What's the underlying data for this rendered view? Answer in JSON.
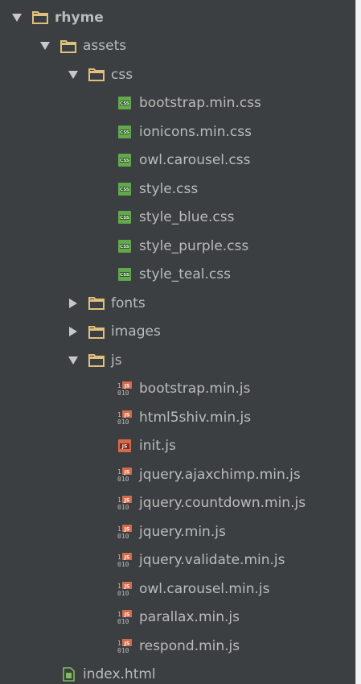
{
  "colors": {
    "background": "#3c3f41",
    "text": "#bbbbbb",
    "folder": "#e0c07a",
    "css_icon": "#62a84d",
    "js_icon": "#d46a4b",
    "html_icon": "#7fbe5a"
  },
  "tree": [
    {
      "label": "rhyme",
      "depth": 0,
      "type": "folder",
      "expanded": true,
      "icon": "folder-icon"
    },
    {
      "label": "assets",
      "depth": 1,
      "type": "folder",
      "expanded": true,
      "icon": "folder-icon"
    },
    {
      "label": "css",
      "depth": 2,
      "type": "folder",
      "expanded": true,
      "icon": "folder-icon"
    },
    {
      "label": "bootstrap.min.css",
      "depth": 3,
      "type": "css",
      "icon": "css-file-icon"
    },
    {
      "label": "ionicons.min.css",
      "depth": 3,
      "type": "css",
      "icon": "css-file-icon"
    },
    {
      "label": "owl.carousel.css",
      "depth": 3,
      "type": "css",
      "icon": "css-file-icon"
    },
    {
      "label": "style.css",
      "depth": 3,
      "type": "css",
      "icon": "css-file-icon"
    },
    {
      "label": "style_blue.css",
      "depth": 3,
      "type": "css",
      "icon": "css-file-icon"
    },
    {
      "label": "style_purple.css",
      "depth": 3,
      "type": "css",
      "icon": "css-file-icon"
    },
    {
      "label": "style_teal.css",
      "depth": 3,
      "type": "css",
      "icon": "css-file-icon"
    },
    {
      "label": "fonts",
      "depth": 2,
      "type": "folder",
      "expanded": false,
      "icon": "folder-icon"
    },
    {
      "label": "images",
      "depth": 2,
      "type": "folder",
      "expanded": false,
      "icon": "folder-icon"
    },
    {
      "label": "js",
      "depth": 2,
      "type": "folder",
      "expanded": true,
      "icon": "folder-icon"
    },
    {
      "label": "bootstrap.min.js",
      "depth": 3,
      "type": "minjs",
      "icon": "minified-js-file-icon"
    },
    {
      "label": "html5shiv.min.js",
      "depth": 3,
      "type": "minjs",
      "icon": "minified-js-file-icon"
    },
    {
      "label": "init.js",
      "depth": 3,
      "type": "js",
      "icon": "js-file-icon"
    },
    {
      "label": "jquery.ajaxchimp.min.js",
      "depth": 3,
      "type": "minjs",
      "icon": "minified-js-file-icon"
    },
    {
      "label": "jquery.countdown.min.js",
      "depth": 3,
      "type": "minjs",
      "icon": "minified-js-file-icon"
    },
    {
      "label": "jquery.min.js",
      "depth": 3,
      "type": "minjs",
      "icon": "minified-js-file-icon"
    },
    {
      "label": "jquery.validate.min.js",
      "depth": 3,
      "type": "minjs",
      "icon": "minified-js-file-icon"
    },
    {
      "label": "owl.carousel.min.js",
      "depth": 3,
      "type": "minjs",
      "icon": "minified-js-file-icon"
    },
    {
      "label": "parallax.min.js",
      "depth": 3,
      "type": "minjs",
      "icon": "minified-js-file-icon"
    },
    {
      "label": "respond.min.js",
      "depth": 3,
      "type": "minjs",
      "icon": "minified-js-file-icon"
    },
    {
      "label": "index.html",
      "depth": 1,
      "type": "html",
      "icon": "html-file-icon"
    }
  ]
}
